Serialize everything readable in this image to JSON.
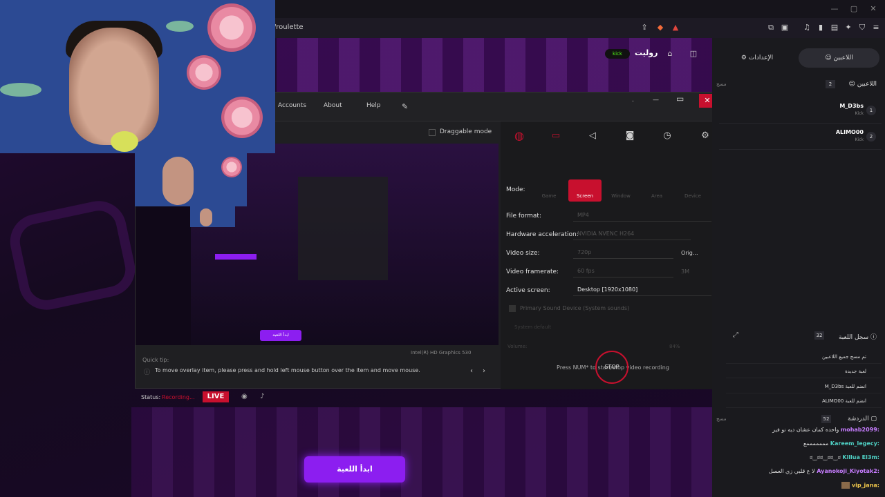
{
  "browser": {
    "url": "y/roulette",
    "window_controls": [
      "—",
      "▢",
      "✕"
    ]
  },
  "site": {
    "title": "روليت",
    "platform_badge": "kick"
  },
  "recorder": {
    "menu": [
      "Accounts",
      "About",
      "Help"
    ],
    "draggable_mode": "Draggable mode",
    "mode_label": "Mode:",
    "modes": [
      "Game",
      "Screen",
      "Window",
      "Area",
      "Device"
    ],
    "active_mode": "Screen",
    "settings": [
      {
        "label": "File format:",
        "value": "MP4"
      },
      {
        "label": "Hardware acceleration:",
        "value": "NVIDIA NVENC H264"
      },
      {
        "label": "Video size:",
        "value": "720p",
        "extra": "Orig..."
      },
      {
        "label": "Video framerate:",
        "value": "60 fps",
        "extra": "3M"
      },
      {
        "label": "Active screen:",
        "value": "Desktop [1920x1080]"
      }
    ],
    "sound_device": "Primary Sound Device (System sounds)",
    "sound_default": "System default",
    "volume_label": "Volume:",
    "volume_pct": "84%",
    "hint": "Press NUM* to start/stop video recording",
    "stop": "STOP",
    "gpu": "Intel(R) HD Graphics 530",
    "quicktip_label": "Quick tip:",
    "quicktip_text": "To move overlay item, please press and hold left mouse button over the item and move mouse.",
    "status_label": "Status:",
    "status_value": "Recording...",
    "live": "LIVE"
  },
  "panel": {
    "tab_players": "اللاعبين",
    "tab_settings": "الإعدادات",
    "players_header": "اللاعبين",
    "players_count": "2",
    "clear": "مسح",
    "players": [
      {
        "name": "M_D3bs",
        "sub": "Kick",
        "num": "1"
      },
      {
        "name": "ALIMO00",
        "sub": "Kick",
        "num": "2"
      }
    ],
    "log_header": "سجل اللعبة",
    "log_count": "32",
    "log": [
      "تم مسح جميع اللاعبين",
      "لعبة جديدة",
      "M_D3bs انضم للعبة",
      "ALIMO00 انضم للعبة"
    ],
    "chat_header": "الدردشة",
    "chat_count": "52",
    "chat_clear": "مسح",
    "chat": [
      {
        "user": "mohab2099:",
        "msg": "واحده كمان عشان ديه نو فير",
        "color": "#c77dff"
      },
      {
        "user": "Kareem_legecy:",
        "msg": "مممممممع",
        "color": "#4fd1c5"
      },
      {
        "user": "Klllua El3m:",
        "msg": "ಠ‿ಠಠ‿ಠಠ‿ಠ",
        "color": "#4fd1c5"
      },
      {
        "user": "Ayanokoji_Kiyotak2:",
        "msg": "لا ع قلبي زي العسل",
        "color": "#c77dff"
      },
      {
        "user": "vip_jana:",
        "msg": "",
        "color": "#f2c94c"
      }
    ]
  },
  "start_button": "ابدأ اللعبة",
  "preview_start_button": "ابدأ اللعبة",
  "colors": {
    "accent_purple": "#8c1ef0",
    "recorder_red": "#c8102e",
    "kick_green": "#53fc18"
  }
}
